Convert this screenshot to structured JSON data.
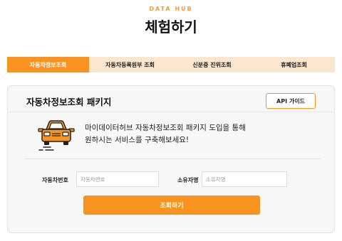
{
  "header": {
    "eyebrow": "DATA HUB",
    "title": "체험하기"
  },
  "tabs": [
    {
      "label": "자동차정보조회",
      "active": true
    },
    {
      "label": "자동차등록원부 조회",
      "active": false
    },
    {
      "label": "신분증 진위조회",
      "active": false
    },
    {
      "label": "휴폐업조회",
      "active": false
    }
  ],
  "card": {
    "title": "자동차정보조회 패키지",
    "api_guide_label": "API 가이드",
    "icon": "car-icon",
    "description_line1": "마이데이터허브 자동차정보조회 패키지 도입을 통해",
    "description_line2": "원하시는 서비스를 구축해보세요!"
  },
  "form": {
    "car_number_label": "자동차번호",
    "car_number_placeholder": "자동차번호",
    "owner_label": "소유자명",
    "owner_placeholder": "소유자명",
    "submit_label": "조회하기"
  },
  "colors": {
    "accent": "#f7931e",
    "tab_bg": "#fde6cf",
    "card_bg": "#f7f7f7"
  }
}
